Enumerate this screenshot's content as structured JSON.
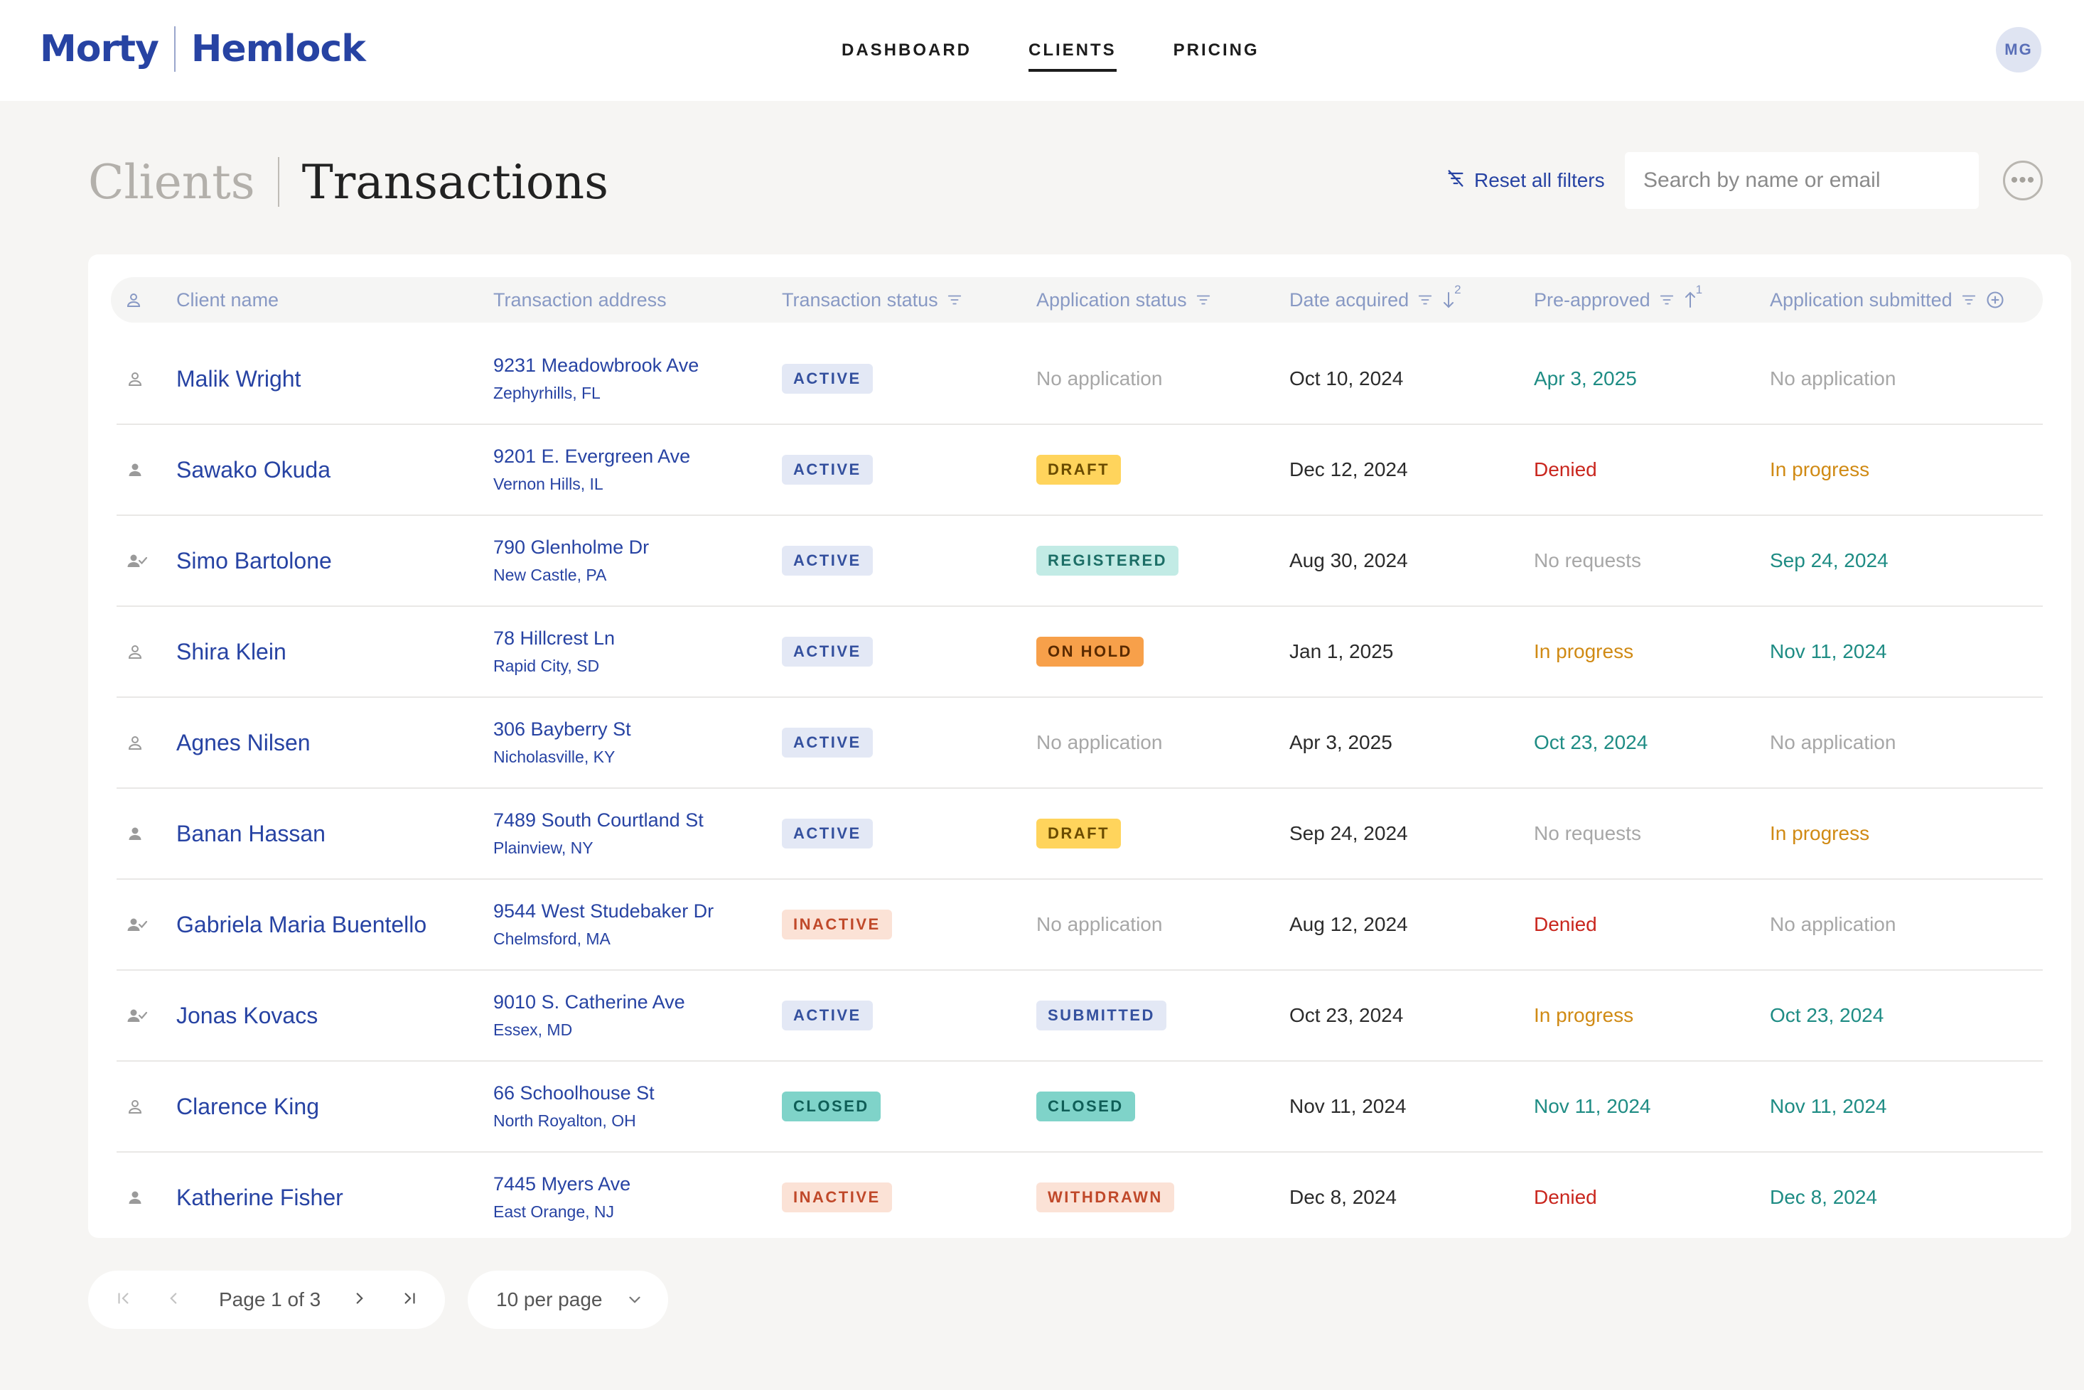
{
  "brand": {
    "left": "Morty",
    "right": "Hemlock"
  },
  "nav": [
    {
      "label": "DASHBOARD",
      "active": false
    },
    {
      "label": "CLIENTS",
      "active": true
    },
    {
      "label": "PRICING",
      "active": false
    }
  ],
  "user": {
    "initials": "MG"
  },
  "page": {
    "crumb": "Clients",
    "title": "Transactions"
  },
  "toolbar": {
    "reset_label": "Reset all filters",
    "search_placeholder": "Search by name or email",
    "more_label": "•••"
  },
  "table": {
    "headers": {
      "client_name": "Client name",
      "address": "Transaction address",
      "transaction_status": "Transaction status",
      "application_status": "Application status",
      "date_acquired": "Date acquired",
      "pre_approved": "Pre-approved",
      "application_submitted": "Application submitted"
    },
    "sort_badges": {
      "date_acquired": "2",
      "pre_approved": "1"
    },
    "rows": [
      {
        "icon": "person-icon",
        "name": "Malik Wright",
        "street": "9231 Meadowbrook Ave",
        "city": "Zephyrhills, FL",
        "tstatus": "ACTIVE",
        "astatus": "No application",
        "date": "Oct 10, 2024",
        "pre": "Apr 3, 2025",
        "pre_tone": "green",
        "sub": "No application",
        "sub_tone": "gray"
      },
      {
        "icon": "person-filled-icon",
        "name": "Sawako Okuda",
        "street": "9201 E. Evergreen Ave",
        "city": "Vernon Hills, IL",
        "tstatus": "ACTIVE",
        "astatus": "DRAFT",
        "date": "Dec 12, 2024",
        "pre": "Denied",
        "pre_tone": "red",
        "sub": "In progress",
        "sub_tone": "orange"
      },
      {
        "icon": "person-check-icon",
        "name": "Simo Bartolone",
        "street": "790 Glenholme Dr",
        "city": "New Castle, PA",
        "tstatus": "ACTIVE",
        "astatus": "REGISTERED",
        "date": "Aug 30, 2024",
        "pre": "No requests",
        "pre_tone": "gray",
        "sub": "Sep 24, 2024",
        "sub_tone": "green"
      },
      {
        "icon": "person-icon",
        "name": "Shira Klein",
        "street": "78 Hillcrest Ln",
        "city": "Rapid City, SD",
        "tstatus": "ACTIVE",
        "astatus": "ON HOLD",
        "date": "Jan 1, 2025",
        "pre": "In progress",
        "pre_tone": "orange",
        "sub": "Nov 11, 2024",
        "sub_tone": "green"
      },
      {
        "icon": "person-icon",
        "name": "Agnes Nilsen",
        "street": "306 Bayberry St",
        "city": "Nicholasville, KY",
        "tstatus": "ACTIVE",
        "astatus": "No application",
        "date": "Apr 3, 2025",
        "pre": "Oct 23, 2024",
        "pre_tone": "green",
        "sub": "No application",
        "sub_tone": "gray"
      },
      {
        "icon": "person-filled-icon",
        "name": "Banan Hassan",
        "street": "7489 South Courtland St",
        "city": "Plainview, NY",
        "tstatus": "ACTIVE",
        "astatus": "DRAFT",
        "date": "Sep 24, 2024",
        "pre": "No requests",
        "pre_tone": "gray",
        "sub": "In progress",
        "sub_tone": "orange"
      },
      {
        "icon": "person-check-icon",
        "name": "Gabriela Maria Buentello",
        "street": "9544 West Studebaker Dr",
        "city": "Chelmsford, MA",
        "tstatus": "INACTIVE",
        "astatus": "No application",
        "date": "Aug 12, 2024",
        "pre": "Denied",
        "pre_tone": "red",
        "sub": "No application",
        "sub_tone": "gray"
      },
      {
        "icon": "person-check-icon",
        "name": "Jonas Kovacs",
        "street": "9010 S. Catherine Ave",
        "city": "Essex, MD",
        "tstatus": "ACTIVE",
        "astatus": "SUBMITTED",
        "date": "Oct 23, 2024",
        "pre": "In progress",
        "pre_tone": "orange",
        "sub": "Oct 23, 2024",
        "sub_tone": "green"
      },
      {
        "icon": "person-icon",
        "name": "Clarence King",
        "street": "66 Schoolhouse St",
        "city": "North Royalton, OH",
        "tstatus": "CLOSED",
        "astatus": "CLOSED",
        "date": "Nov 11, 2024",
        "pre": "Nov 11, 2024",
        "pre_tone": "green",
        "sub": "Nov 11, 2024",
        "sub_tone": "green"
      },
      {
        "icon": "person-filled-icon",
        "name": "Katherine Fisher",
        "street": "7445 Myers Ave",
        "city": "East Orange, NJ",
        "tstatus": "INACTIVE",
        "astatus": "WITHDRAWN",
        "date": "Dec 8, 2024",
        "pre": "Denied",
        "pre_tone": "red",
        "sub": "Dec 8, 2024",
        "sub_tone": "green"
      }
    ]
  },
  "pagination": {
    "label": "Page 1 of 3",
    "per_page": "10 per page"
  },
  "colors": {
    "brand": "#2743a3",
    "green": "#1e8c84",
    "red": "#c9261e",
    "orange": "#d08a14",
    "gray": "#a7a7a7",
    "badges": {
      "ACTIVE": {
        "bg": "#e3e8f5",
        "fg": "#34509e"
      },
      "INACTIVE": {
        "bg": "#fbe2d6",
        "fg": "#c0492a"
      },
      "CLOSED": {
        "bg": "#7fd3c9",
        "fg": "#0f5e57"
      },
      "DRAFT": {
        "bg": "#ffd45c",
        "fg": "#6a4b00"
      },
      "REGISTERED": {
        "bg": "#c2ebe5",
        "fg": "#1c6e66"
      },
      "ON HOLD": {
        "bg": "#f7a04a",
        "fg": "#5a2a00"
      },
      "SUBMITTED": {
        "bg": "#e3e8f5",
        "fg": "#34509e"
      },
      "WITHDRAWN": {
        "bg": "#fbe2d6",
        "fg": "#c0492a"
      }
    }
  }
}
